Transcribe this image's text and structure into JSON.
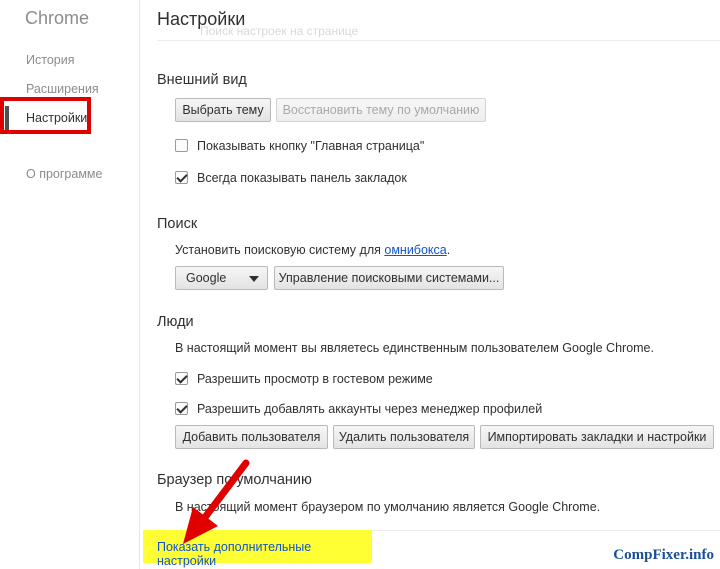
{
  "sidebar": {
    "brand": "Chrome",
    "items": [
      {
        "label": "История"
      },
      {
        "label": "Расширения"
      },
      {
        "label": "Настройки"
      },
      {
        "label": "О программе"
      }
    ]
  },
  "header": {
    "title": "Настройки",
    "search_ghost": "Поиск настроек на странице"
  },
  "appearance": {
    "title": "Внешний вид",
    "choose_theme": "Выбрать тему",
    "reset_theme": "Восстановить тему по умолчанию",
    "show_home_button": {
      "label": "Показывать кнопку \"Главная страница\"",
      "checked": false
    },
    "show_bookmarks_bar": {
      "label": "Всегда показывать панель закладок",
      "checked": true
    }
  },
  "search": {
    "title": "Поиск",
    "description_prefix": "Установить поисковую систему для ",
    "description_link": "омнибокса",
    "description_suffix": ".",
    "engine_selected": "Google",
    "manage_engines": "Управление поисковыми системами..."
  },
  "people": {
    "title": "Люди",
    "description": "В настоящий момент вы являетесь единственным пользователем Google Chrome.",
    "guest_browsing": {
      "label": "Разрешить просмотр в гостевом режиме",
      "checked": true
    },
    "add_via_manager": {
      "label": "Разрешить добавлять аккаунты через менеджер профилей",
      "checked": true
    },
    "add_user": "Добавить пользователя",
    "remove_user": "Удалить пользователя",
    "import_bookmarks": "Импортировать закладки и настройки"
  },
  "default_browser": {
    "title": "Браузер по умолчанию",
    "description": "В настоящий момент браузером по умолчанию является Google Chrome."
  },
  "footer": {
    "show_advanced": "Показать дополнительные настройки",
    "watermark": "CompFixer.info"
  },
  "colors": {
    "highlight": "#ffff33",
    "annotation_red": "#e00000",
    "link": "#1155cc"
  }
}
